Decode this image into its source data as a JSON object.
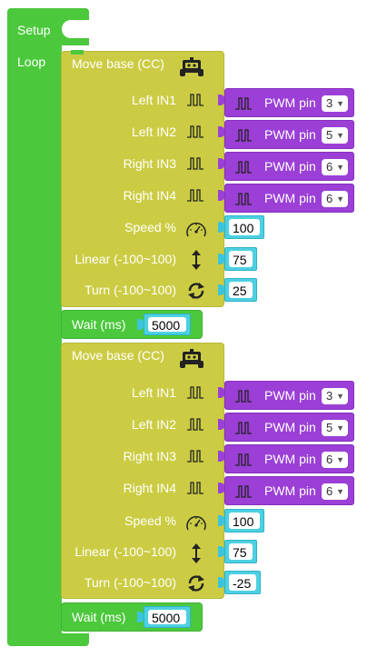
{
  "root": {
    "setup_label": "Setup",
    "loop_label": "Loop"
  },
  "pulse_icon": "pulse-wave-icon",
  "robot_icon": "robot-car-icon",
  "speed_icon": "speedometer-icon",
  "linear_icon": "up-down-arrows-icon",
  "turn_icon": "rotate-arrows-icon",
  "colors": {
    "control": "#4cc83c",
    "motor_block": "#cccc44",
    "pin_block": "#9b3fd6",
    "number": "#4dd0e1"
  },
  "blocks": [
    {
      "title": "Move base (CC)",
      "left_in1": "Left IN1",
      "left_in2": "Left IN2",
      "right_in3": "Right IN3",
      "right_in4": "Right IN4",
      "pwm_label": "PWM pin",
      "pin1": "3",
      "pin2": "5",
      "pin3": "6",
      "pin4": "6",
      "speed_label": "Speed %",
      "speed_value": "100",
      "linear_label": "Linear (-100~100)",
      "linear_value": "75",
      "turn_label": "Turn (-100~100)",
      "turn_value": "25",
      "wait_label": "Wait (ms)",
      "wait_value": "5000"
    },
    {
      "title": "Move base (CC)",
      "left_in1": "Left IN1",
      "left_in2": "Left IN2",
      "right_in3": "Right IN3",
      "right_in4": "Right IN4",
      "pwm_label": "PWM pin",
      "pin1": "3",
      "pin2": "5",
      "pin3": "6",
      "pin4": "6",
      "speed_label": "Speed %",
      "speed_value": "100",
      "linear_label": "Linear (-100~100)",
      "linear_value": "75",
      "turn_label": "Turn (-100~100)",
      "turn_value": "-25",
      "wait_label": "Wait (ms)",
      "wait_value": "5000"
    }
  ]
}
